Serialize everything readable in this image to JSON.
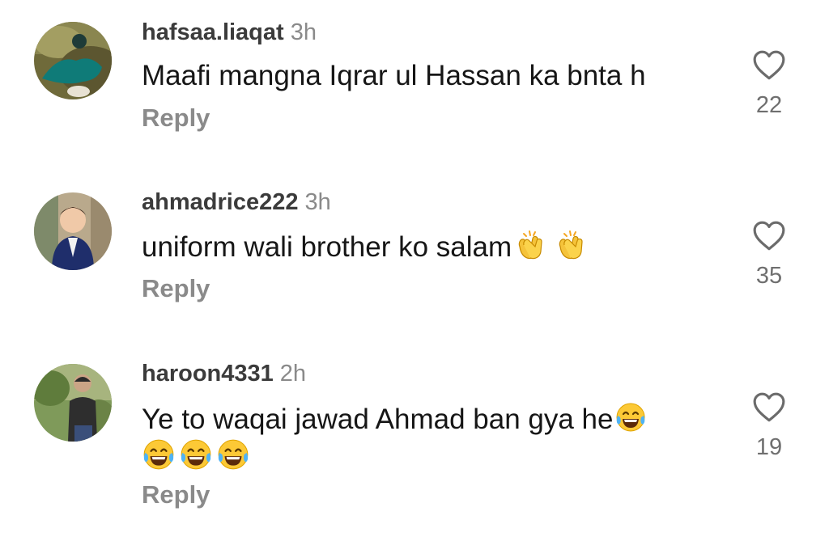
{
  "comments": [
    {
      "username": "hafsaa.liaqat",
      "time": "3h",
      "text": "Maafi mangna Iqrar ul Hassan ka bnta h",
      "reply_label": "Reply",
      "likes": "22",
      "avatar_icon": "profile-photo-woman-in-teal"
    },
    {
      "username": "ahmadrice222",
      "time": "3h",
      "text": "uniform wali brother ko salam",
      "emojis": [
        "clapping-hands",
        "clapping-hands"
      ],
      "reply_label": "Reply",
      "likes": "35",
      "avatar_icon": "profile-photo-child-in-vest"
    },
    {
      "username": "haroon4331",
      "time": "2h",
      "text": "Ye to waqai jawad Ahmad ban gya he",
      "emojis": [
        "tears-of-joy",
        "tears-of-joy",
        "tears-of-joy",
        "tears-of-joy"
      ],
      "reply_label": "Reply",
      "likes": "19",
      "avatar_icon": "profile-photo-man-outdoors"
    }
  ],
  "colors": {
    "username": "#3b3b3b",
    "meta": "#8a8a8a",
    "text": "#161616",
    "like_count": "#6f6f6f"
  }
}
